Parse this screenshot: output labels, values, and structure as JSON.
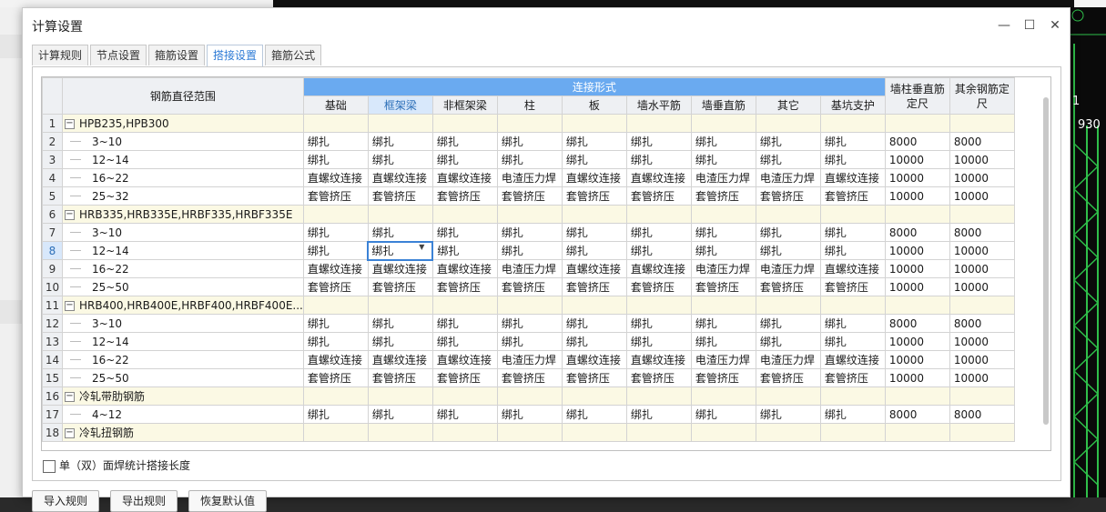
{
  "window": {
    "title": "计算设置",
    "minimize_label": "—",
    "maximize_label": "☐",
    "close_label": "✕"
  },
  "tabs": [
    {
      "label": "计算规则",
      "active": false
    },
    {
      "label": "节点设置",
      "active": false
    },
    {
      "label": "箍筋设置",
      "active": false
    },
    {
      "label": "搭接设置",
      "active": true
    },
    {
      "label": "箍筋公式",
      "active": false
    }
  ],
  "grid": {
    "header": {
      "range_label": "钢筋直径范围",
      "group_label": "连接形式",
      "columns": [
        "基础",
        "框架梁",
        "非框架梁",
        "柱",
        "板",
        "墙水平筋",
        "墙垂直筋",
        "其它",
        "基坑支护"
      ],
      "wall_col_label": "墙柱垂直筋定尺",
      "other_col_label": "其余钢筋定尺",
      "selected_column_index": 1
    },
    "rows": [
      {
        "n": "1",
        "type": "category",
        "name": "HPB235,HPB300",
        "expander": "−"
      },
      {
        "n": "2",
        "type": "data",
        "name": "3~10",
        "cells": [
          "绑扎",
          "绑扎",
          "绑扎",
          "绑扎",
          "绑扎",
          "绑扎",
          "绑扎",
          "绑扎",
          "绑扎"
        ],
        "wall": "8000",
        "other": "8000"
      },
      {
        "n": "3",
        "type": "data",
        "name": "12~14",
        "cells": [
          "绑扎",
          "绑扎",
          "绑扎",
          "绑扎",
          "绑扎",
          "绑扎",
          "绑扎",
          "绑扎",
          "绑扎"
        ],
        "wall": "10000",
        "other": "10000"
      },
      {
        "n": "4",
        "type": "data",
        "name": "16~22",
        "cells": [
          "直螺纹连接",
          "直螺纹连接",
          "直螺纹连接",
          "电渣压力焊",
          "直螺纹连接",
          "直螺纹连接",
          "电渣压力焊",
          "电渣压力焊",
          "直螺纹连接"
        ],
        "wall": "10000",
        "other": "10000"
      },
      {
        "n": "5",
        "type": "data",
        "name": "25~32",
        "cells": [
          "套管挤压",
          "套管挤压",
          "套管挤压",
          "套管挤压",
          "套管挤压",
          "套管挤压",
          "套管挤压",
          "套管挤压",
          "套管挤压"
        ],
        "wall": "10000",
        "other": "10000"
      },
      {
        "n": "6",
        "type": "category",
        "name": "HRB335,HRB335E,HRBF335,HRBF335E",
        "expander": "−"
      },
      {
        "n": "7",
        "type": "data",
        "name": "3~10",
        "cells": [
          "绑扎",
          "绑扎",
          "绑扎",
          "绑扎",
          "绑扎",
          "绑扎",
          "绑扎",
          "绑扎",
          "绑扎"
        ],
        "wall": "8000",
        "other": "8000"
      },
      {
        "n": "8",
        "type": "data",
        "name": "12~14",
        "selected": true,
        "cells": [
          "绑扎",
          "绑扎",
          "绑扎",
          "绑扎",
          "绑扎",
          "绑扎",
          "绑扎",
          "绑扎",
          "绑扎"
        ],
        "wall": "10000",
        "other": "10000"
      },
      {
        "n": "9",
        "type": "data",
        "name": "16~22",
        "cells": [
          "直螺纹连接",
          "直螺纹连接",
          "直螺纹连接",
          "电渣压力焊",
          "直螺纹连接",
          "直螺纹连接",
          "电渣压力焊",
          "电渣压力焊",
          "直螺纹连接"
        ],
        "wall": "10000",
        "other": "10000"
      },
      {
        "n": "10",
        "type": "data",
        "name": "25~50",
        "cells": [
          "套管挤压",
          "套管挤压",
          "套管挤压",
          "套管挤压",
          "套管挤压",
          "套管挤压",
          "套管挤压",
          "套管挤压",
          "套管挤压"
        ],
        "wall": "10000",
        "other": "10000"
      },
      {
        "n": "11",
        "type": "category",
        "name": "HRB400,HRB400E,HRBF400,HRBF400E...",
        "expander": "−"
      },
      {
        "n": "12",
        "type": "data",
        "name": "3~10",
        "cells": [
          "绑扎",
          "绑扎",
          "绑扎",
          "绑扎",
          "绑扎",
          "绑扎",
          "绑扎",
          "绑扎",
          "绑扎"
        ],
        "wall": "8000",
        "other": "8000"
      },
      {
        "n": "13",
        "type": "data",
        "name": "12~14",
        "cells": [
          "绑扎",
          "绑扎",
          "绑扎",
          "绑扎",
          "绑扎",
          "绑扎",
          "绑扎",
          "绑扎",
          "绑扎"
        ],
        "wall": "10000",
        "other": "10000"
      },
      {
        "n": "14",
        "type": "data",
        "name": "16~22",
        "cells": [
          "直螺纹连接",
          "直螺纹连接",
          "直螺纹连接",
          "电渣压力焊",
          "直螺纹连接",
          "直螺纹连接",
          "电渣压力焊",
          "电渣压力焊",
          "直螺纹连接"
        ],
        "wall": "10000",
        "other": "10000"
      },
      {
        "n": "15",
        "type": "data",
        "name": "25~50",
        "cells": [
          "套管挤压",
          "套管挤压",
          "套管挤压",
          "套管挤压",
          "套管挤压",
          "套管挤压",
          "套管挤压",
          "套管挤压",
          "套管挤压"
        ],
        "wall": "10000",
        "other": "10000"
      },
      {
        "n": "16",
        "type": "category",
        "name": "冷轧带肋钢筋",
        "expander": "−"
      },
      {
        "n": "17",
        "type": "data",
        "name": "4~12",
        "cells": [
          "绑扎",
          "绑扎",
          "绑扎",
          "绑扎",
          "绑扎",
          "绑扎",
          "绑扎",
          "绑扎",
          "绑扎"
        ],
        "wall": "8000",
        "other": "8000"
      },
      {
        "n": "18",
        "type": "category",
        "name": "冷轧扭钢筋",
        "expander": "−"
      }
    ]
  },
  "options": {
    "weld_label": "单（双）面焊统计搭接长度",
    "weld_checked": false
  },
  "bottom_buttons": [
    "导入规则",
    "导出规则",
    "恢复默认值"
  ],
  "background": {
    "right_numbers": [
      "1",
      "930"
    ],
    "cad_color": "#2fbf4a"
  }
}
